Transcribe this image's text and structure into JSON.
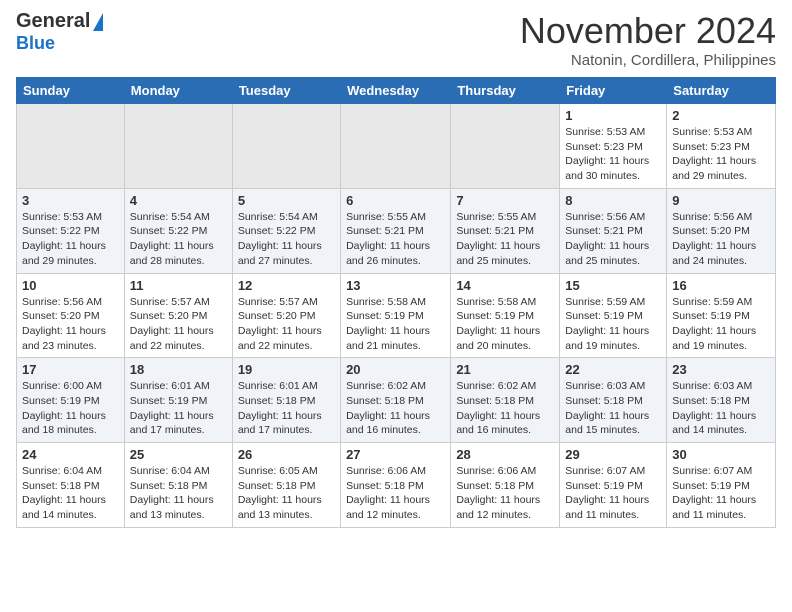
{
  "header": {
    "logo_general": "General",
    "logo_blue": "Blue",
    "month_title": "November 2024",
    "location": "Natonin, Cordillera, Philippines"
  },
  "days_of_week": [
    "Sunday",
    "Monday",
    "Tuesday",
    "Wednesday",
    "Thursday",
    "Friday",
    "Saturday"
  ],
  "weeks": [
    [
      {
        "day": "",
        "info": ""
      },
      {
        "day": "",
        "info": ""
      },
      {
        "day": "",
        "info": ""
      },
      {
        "day": "",
        "info": ""
      },
      {
        "day": "",
        "info": ""
      },
      {
        "day": "1",
        "info": "Sunrise: 5:53 AM\nSunset: 5:23 PM\nDaylight: 11 hours\nand 30 minutes."
      },
      {
        "day": "2",
        "info": "Sunrise: 5:53 AM\nSunset: 5:23 PM\nDaylight: 11 hours\nand 29 minutes."
      }
    ],
    [
      {
        "day": "3",
        "info": "Sunrise: 5:53 AM\nSunset: 5:22 PM\nDaylight: 11 hours\nand 29 minutes."
      },
      {
        "day": "4",
        "info": "Sunrise: 5:54 AM\nSunset: 5:22 PM\nDaylight: 11 hours\nand 28 minutes."
      },
      {
        "day": "5",
        "info": "Sunrise: 5:54 AM\nSunset: 5:22 PM\nDaylight: 11 hours\nand 27 minutes."
      },
      {
        "day": "6",
        "info": "Sunrise: 5:55 AM\nSunset: 5:21 PM\nDaylight: 11 hours\nand 26 minutes."
      },
      {
        "day": "7",
        "info": "Sunrise: 5:55 AM\nSunset: 5:21 PM\nDaylight: 11 hours\nand 25 minutes."
      },
      {
        "day": "8",
        "info": "Sunrise: 5:56 AM\nSunset: 5:21 PM\nDaylight: 11 hours\nand 25 minutes."
      },
      {
        "day": "9",
        "info": "Sunrise: 5:56 AM\nSunset: 5:20 PM\nDaylight: 11 hours\nand 24 minutes."
      }
    ],
    [
      {
        "day": "10",
        "info": "Sunrise: 5:56 AM\nSunset: 5:20 PM\nDaylight: 11 hours\nand 23 minutes."
      },
      {
        "day": "11",
        "info": "Sunrise: 5:57 AM\nSunset: 5:20 PM\nDaylight: 11 hours\nand 22 minutes."
      },
      {
        "day": "12",
        "info": "Sunrise: 5:57 AM\nSunset: 5:20 PM\nDaylight: 11 hours\nand 22 minutes."
      },
      {
        "day": "13",
        "info": "Sunrise: 5:58 AM\nSunset: 5:19 PM\nDaylight: 11 hours\nand 21 minutes."
      },
      {
        "day": "14",
        "info": "Sunrise: 5:58 AM\nSunset: 5:19 PM\nDaylight: 11 hours\nand 20 minutes."
      },
      {
        "day": "15",
        "info": "Sunrise: 5:59 AM\nSunset: 5:19 PM\nDaylight: 11 hours\nand 19 minutes."
      },
      {
        "day": "16",
        "info": "Sunrise: 5:59 AM\nSunset: 5:19 PM\nDaylight: 11 hours\nand 19 minutes."
      }
    ],
    [
      {
        "day": "17",
        "info": "Sunrise: 6:00 AM\nSunset: 5:19 PM\nDaylight: 11 hours\nand 18 minutes."
      },
      {
        "day": "18",
        "info": "Sunrise: 6:01 AM\nSunset: 5:19 PM\nDaylight: 11 hours\nand 17 minutes."
      },
      {
        "day": "19",
        "info": "Sunrise: 6:01 AM\nSunset: 5:18 PM\nDaylight: 11 hours\nand 17 minutes."
      },
      {
        "day": "20",
        "info": "Sunrise: 6:02 AM\nSunset: 5:18 PM\nDaylight: 11 hours\nand 16 minutes."
      },
      {
        "day": "21",
        "info": "Sunrise: 6:02 AM\nSunset: 5:18 PM\nDaylight: 11 hours\nand 16 minutes."
      },
      {
        "day": "22",
        "info": "Sunrise: 6:03 AM\nSunset: 5:18 PM\nDaylight: 11 hours\nand 15 minutes."
      },
      {
        "day": "23",
        "info": "Sunrise: 6:03 AM\nSunset: 5:18 PM\nDaylight: 11 hours\nand 14 minutes."
      }
    ],
    [
      {
        "day": "24",
        "info": "Sunrise: 6:04 AM\nSunset: 5:18 PM\nDaylight: 11 hours\nand 14 minutes."
      },
      {
        "day": "25",
        "info": "Sunrise: 6:04 AM\nSunset: 5:18 PM\nDaylight: 11 hours\nand 13 minutes."
      },
      {
        "day": "26",
        "info": "Sunrise: 6:05 AM\nSunset: 5:18 PM\nDaylight: 11 hours\nand 13 minutes."
      },
      {
        "day": "27",
        "info": "Sunrise: 6:06 AM\nSunset: 5:18 PM\nDaylight: 11 hours\nand 12 minutes."
      },
      {
        "day": "28",
        "info": "Sunrise: 6:06 AM\nSunset: 5:18 PM\nDaylight: 11 hours\nand 12 minutes."
      },
      {
        "day": "29",
        "info": "Sunrise: 6:07 AM\nSunset: 5:19 PM\nDaylight: 11 hours\nand 11 minutes."
      },
      {
        "day": "30",
        "info": "Sunrise: 6:07 AM\nSunset: 5:19 PM\nDaylight: 11 hours\nand 11 minutes."
      }
    ]
  ]
}
